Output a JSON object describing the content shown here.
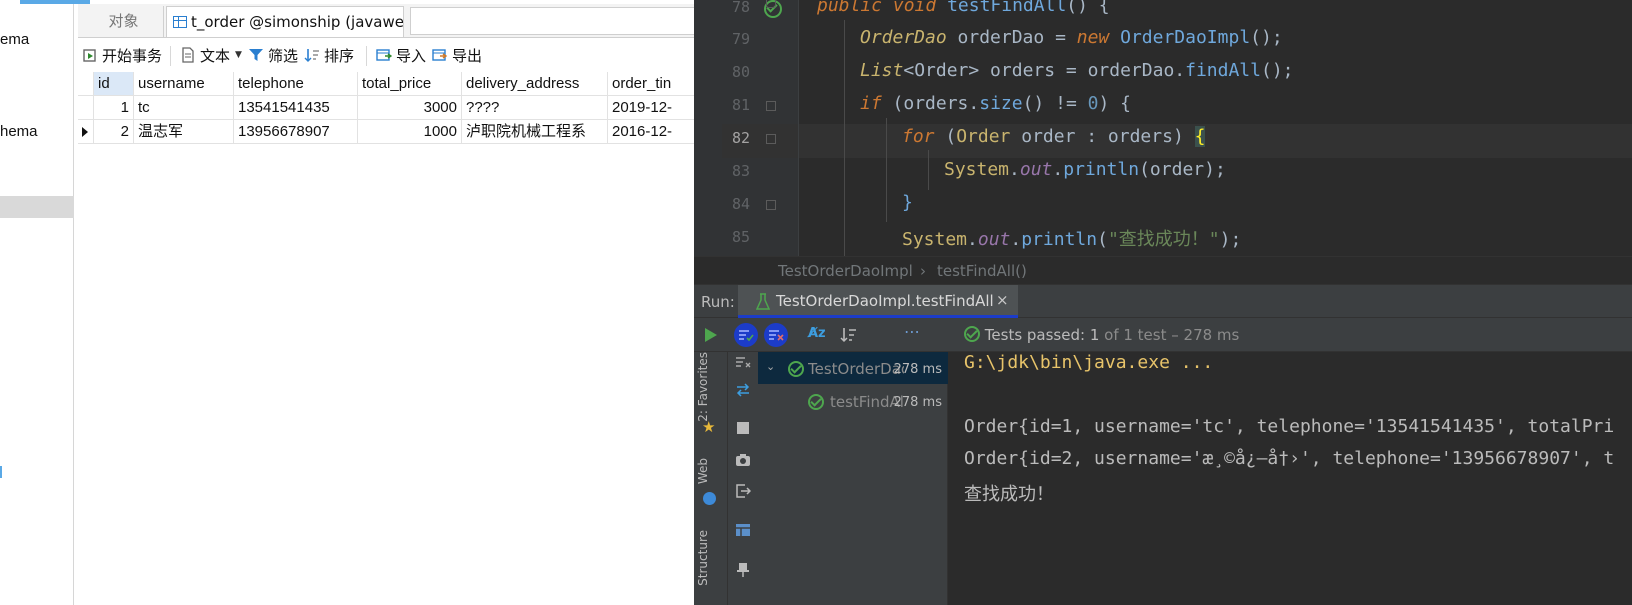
{
  "db_tool": {
    "nav_items": [
      "ema",
      "hema"
    ],
    "tabs": {
      "objects": "对象",
      "table_tab": "t_order @simonship (javawe..."
    },
    "toolbar": {
      "begin_transaction": "开始事务",
      "text": "文本",
      "filter": "筛选",
      "sort": "排序",
      "import": "导入",
      "export": "导出"
    },
    "columns": [
      "id",
      "username",
      "telephone",
      "total_price",
      "delivery_address",
      "order_tin"
    ],
    "rows": [
      {
        "id": "1",
        "username": "tc",
        "telephone": "13541541435",
        "total_price": "3000",
        "delivery_address": "????",
        "order_time": "2019-12-"
      },
      {
        "id": "2",
        "username": "温志军",
        "telephone": "13956678907",
        "total_price": "1000",
        "delivery_address": "泸职院机械工程系",
        "order_time": "2016-12-"
      }
    ]
  },
  "ide": {
    "line_numbers": [
      "78",
      "79",
      "80",
      "81",
      "82",
      "83",
      "84",
      "85"
    ],
    "code": {
      "l78": {
        "kw1": "public",
        "kw2": "void",
        "name": "testFindAll",
        "rest": "() {"
      },
      "l79": {
        "type": "OrderDao",
        "var": " orderDao = ",
        "kw": "new",
        "ctor": "OrderDaoImpl",
        "rest": "();"
      },
      "l80": {
        "type": "List",
        "generic": "<Order>",
        "var": " orders = orderDao.",
        "call": "findAll",
        "rest": "();"
      },
      "l81": {
        "kw": "if",
        "pre": " (orders.",
        "call": "size",
        "mid": "() != ",
        "num": "0",
        "rest": ") {"
      },
      "l82": {
        "kw": "for",
        "pre": " (",
        "type": "Order",
        "rest": " order : orders) ",
        "brace": "{"
      },
      "l83": {
        "sys": "System",
        "dot": ".",
        "field": "out",
        "dot2": ".",
        "call": "println",
        "rest": "(order);"
      },
      "l84": {
        "brace": "}"
      },
      "l85": {
        "sys": "System",
        "dot": ".",
        "field": "out",
        "dot2": ".",
        "call": "println",
        "open": "(",
        "str": "\"查找成功！\"",
        "rest": ");"
      }
    },
    "breadcrumb": {
      "class": "TestOrderDaoImpl",
      "sep": "›",
      "method": "testFindAll()"
    },
    "run": {
      "label": "Run:",
      "tab_title": "TestOrderDaoImpl.testFindAll",
      "close": "×",
      "status_main": "Tests passed: 1",
      "status_rest": " of 1 test – 278 ms"
    },
    "side_labels": {
      "favorites": "2: Favorites",
      "web": "Web",
      "structure": "Structure"
    },
    "tree": [
      {
        "name": "TestOrderDac",
        "time": "278 ms"
      },
      {
        "name": "testFindAll",
        "time": "278 ms"
      }
    ],
    "console": [
      "G:\\jdk\\bin\\java.exe ...",
      "",
      "Order{id=1, username='tc', telephone='13541541435', totalPri",
      "Order{id=2, username='æ¸©å¿—å†›', telephone='13956678907', t",
      "查找成功！"
    ],
    "colors": {
      "pass_green": "#4ea64e",
      "editor_bg": "#2b2b2b",
      "panel_bg": "#3c3f41",
      "accent_blue": "#1c3cc9"
    }
  }
}
